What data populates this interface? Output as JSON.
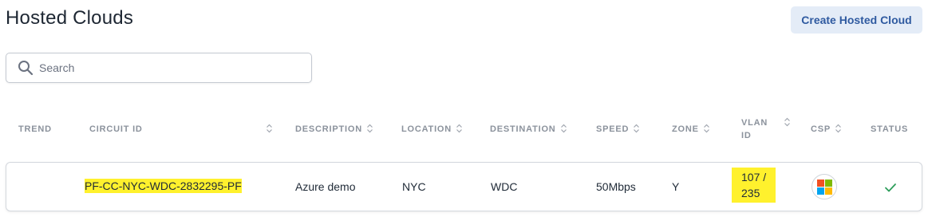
{
  "page": {
    "title": "Hosted Clouds"
  },
  "actions": {
    "create_label": "Create Hosted Cloud"
  },
  "search": {
    "placeholder": "Search",
    "value": ""
  },
  "table": {
    "columns": [
      {
        "key": "trend",
        "label": "TREND",
        "sortable": false
      },
      {
        "key": "circuit_id",
        "label": "CIRCUIT ID",
        "sortable": true
      },
      {
        "key": "description",
        "label": "DESCRIPTION",
        "sortable": true
      },
      {
        "key": "location",
        "label": "LOCATION",
        "sortable": true
      },
      {
        "key": "destination",
        "label": "DESTINATION",
        "sortable": true
      },
      {
        "key": "speed",
        "label": "SPEED",
        "sortable": true
      },
      {
        "key": "zone",
        "label": "ZONE",
        "sortable": true
      },
      {
        "key": "vlan_id",
        "label": "VLAN ID",
        "label_line1": "VLAN",
        "label_line2": "ID",
        "sortable": true
      },
      {
        "key": "csp",
        "label": "CSP",
        "sortable": true
      },
      {
        "key": "status",
        "label": "STATUS",
        "sortable": false
      }
    ],
    "rows": [
      {
        "trend": "",
        "circuit_id": "PF-CC-NYC-WDC-2832295-PF",
        "description": "Azure demo",
        "location": "NYC",
        "destination": "WDC",
        "speed": "50Mbps",
        "zone": "Y",
        "vlan_line1": "107 /",
        "vlan_line2": "235",
        "csp_icon": "microsoft-logo-icon",
        "status_icon": "checkmark-icon"
      }
    ]
  },
  "colors": {
    "highlight": "#fff12d",
    "button_bg": "#e4ecf7",
    "button_text": "#2f5aa0",
    "status_ok": "#2e9e5b",
    "ms_red": "#f25022",
    "ms_green": "#7fba00",
    "ms_blue": "#00a4ef",
    "ms_yellow": "#ffb900"
  }
}
